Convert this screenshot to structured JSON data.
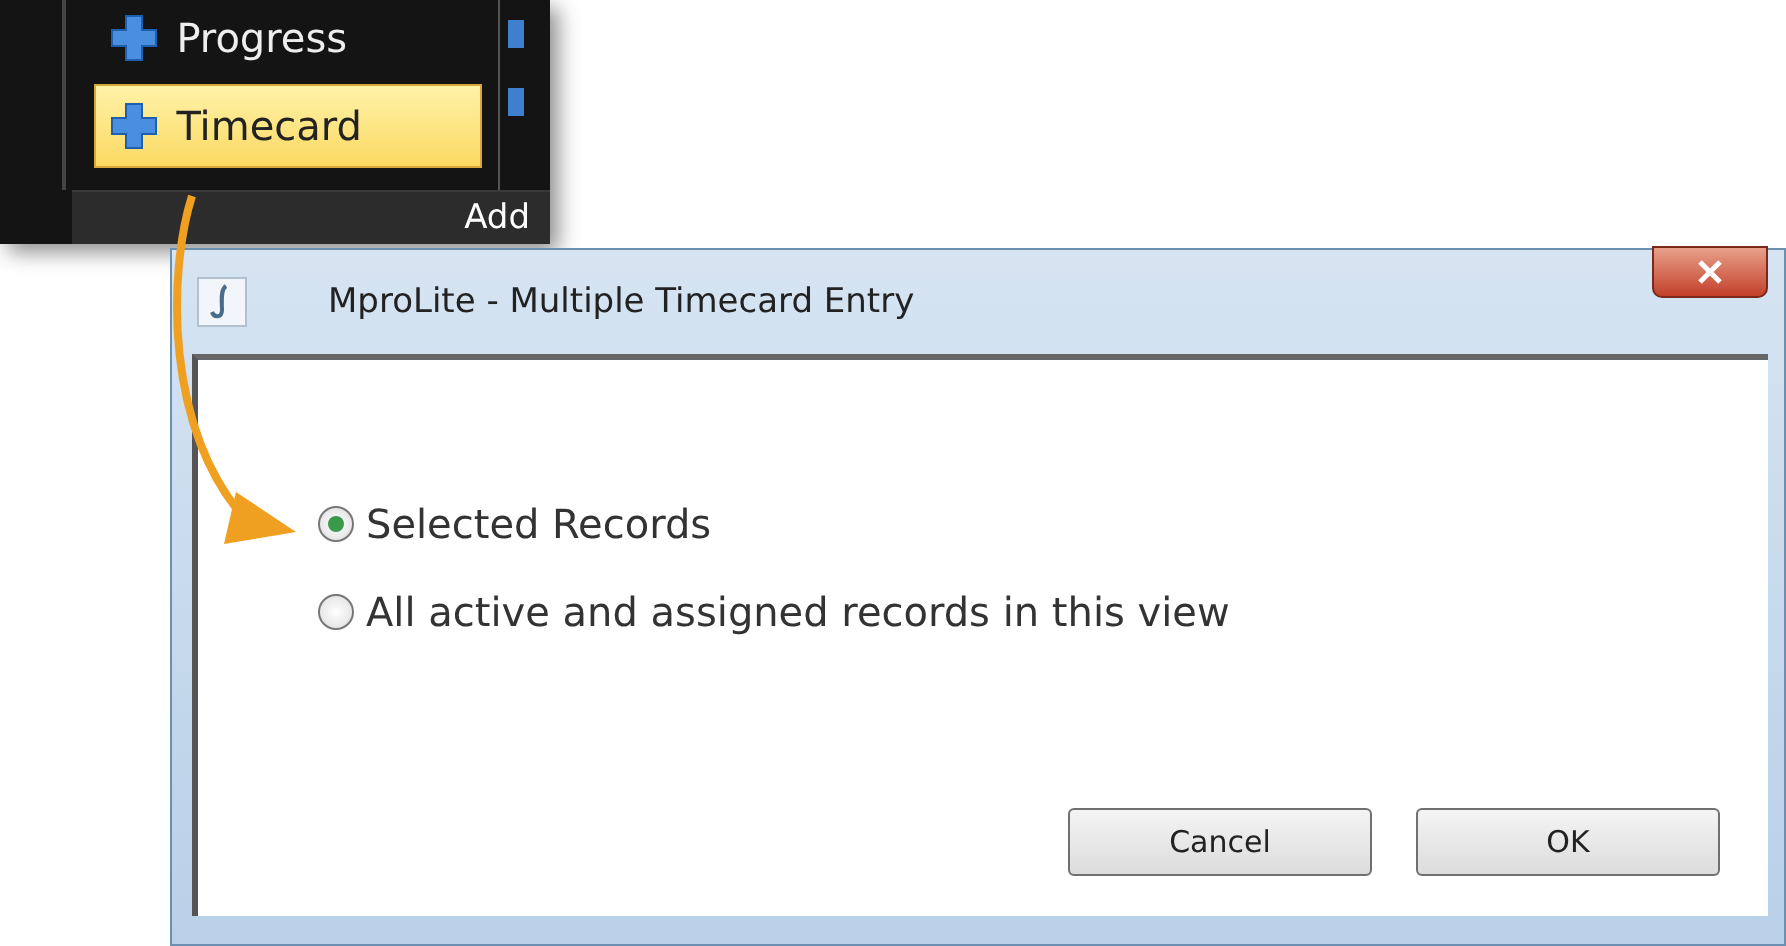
{
  "ribbon": {
    "items": [
      {
        "label": "Progress",
        "selected": false
      },
      {
        "label": "Timecard",
        "selected": true
      }
    ],
    "group_label": "Add"
  },
  "dialog": {
    "title": "MproLite - Multiple Timecard Entry",
    "options": [
      {
        "label": "Selected Records",
        "selected": true
      },
      {
        "label": "All active and assigned records in this view",
        "selected": false
      }
    ],
    "buttons": [
      "Cancel",
      "OK"
    ]
  }
}
